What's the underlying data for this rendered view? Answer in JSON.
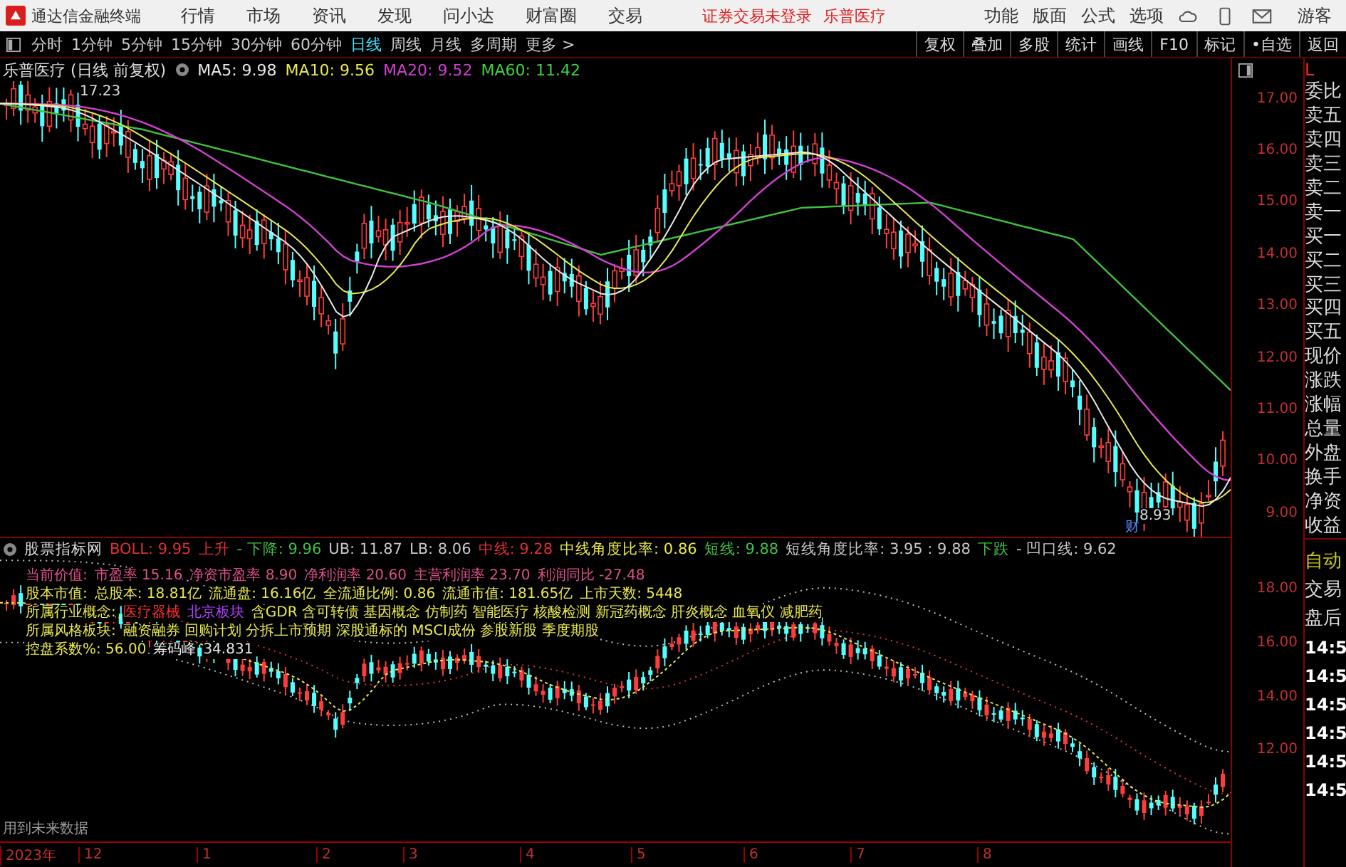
{
  "menu_bar": {
    "app_title": "通达信金融终端",
    "menus": [
      "行情",
      "市场",
      "资讯",
      "发现",
      "问小达",
      "财富圈",
      "交易"
    ],
    "login_status": "证券交易未登录",
    "stock_name": "乐普医疗",
    "right_menus": [
      "功能",
      "版面",
      "公式",
      "选项"
    ],
    "user": "游客"
  },
  "toolbar": {
    "periods": [
      {
        "label": "分时",
        "selected": false
      },
      {
        "label": "1分钟",
        "selected": false
      },
      {
        "label": "5分钟",
        "selected": false
      },
      {
        "label": "15分钟",
        "selected": false
      },
      {
        "label": "30分钟",
        "selected": false
      },
      {
        "label": "60分钟",
        "selected": false
      },
      {
        "label": "日线",
        "selected": true
      },
      {
        "label": "周线",
        "selected": false
      },
      {
        "label": "月线",
        "selected": false
      },
      {
        "label": "多周期",
        "selected": false
      }
    ],
    "more": "更多 >",
    "actions": [
      "复权",
      "叠加",
      "多股",
      "统计",
      "画线",
      "F10",
      "标记",
      "•自选",
      "返回"
    ]
  },
  "main_chart": {
    "title": "乐普医疗 (日线 前复权)",
    "indicators": [
      {
        "text": "MA5: 9.98",
        "color": "#e8e8e8"
      },
      {
        "text": "MA10: 9.56",
        "color": "#e8e850"
      },
      {
        "text": "MA20: 9.52",
        "color": "#d040d0"
      },
      {
        "text": "MA60: 11.42",
        "color": "#40d040"
      }
    ],
    "high_label": "17.23",
    "low_label": "8.93",
    "marker": "财",
    "y_ticks": [
      "17.00",
      "16.00",
      "15.00",
      "14.00",
      "13.00",
      "12.00",
      "11.00",
      "10.00",
      "9.00"
    ]
  },
  "indicator_panel": {
    "title": "股票指标网",
    "readouts": [
      {
        "text": "BOLL: 9.95",
        "color": "#e03030"
      },
      {
        "text": "上升",
        "color": "#e03030"
      },
      {
        "text": "- 下降: 9.96",
        "color": "#40c040"
      },
      {
        "text": "UB: 11.87",
        "color": "#c8c8c8"
      },
      {
        "text": "LB: 8.06",
        "color": "#c8c8c8"
      },
      {
        "text": "中线: 9.28",
        "color": "#e03030"
      },
      {
        "text": "中线角度比率: 0.86",
        "color": "#e8e850"
      },
      {
        "text": "短线: 9.88",
        "color": "#40c040"
      },
      {
        "text": "短线角度比率: 3.95 : 9.88",
        "color": "#c8c8c8"
      },
      {
        "text": "下跌",
        "color": "#40c040"
      },
      {
        "text": "- 凹口线: 9.62",
        "color": "#c8c8c8"
      }
    ],
    "info_rows": [
      [
        {
          "text": "当前价值:",
          "color": "#e0508a"
        },
        {
          "text": "市盈率 15.16",
          "color": "#e0508a"
        },
        {
          "text": "净资市盈率 8.90",
          "color": "#e0508a"
        },
        {
          "text": "净利润率 20.60",
          "color": "#e0508a"
        },
        {
          "text": "主营利润率 23.70",
          "color": "#e0508a"
        },
        {
          "text": "利润同比 -27.48",
          "color": "#e0508a"
        }
      ],
      [
        {
          "text": "股本市值:",
          "color": "#e8e850"
        },
        {
          "text": "总股本: 18.81亿",
          "color": "#e8e850"
        },
        {
          "text": "流通盘: 16.16亿",
          "color": "#e8e850"
        },
        {
          "text": "全流通比例: 0.86",
          "color": "#e8e850"
        },
        {
          "text": "流通市值: 181.65亿",
          "color": "#e8e850"
        },
        {
          "text": "上市天数: 5448",
          "color": "#e8e850"
        }
      ],
      [
        {
          "text": "所属行业概念:",
          "color": "#e8e850"
        },
        {
          "text": "医疗器械",
          "color": "#ff3030"
        },
        {
          "text": "北京板块",
          "color": "#b040ff"
        },
        {
          "text": "含GDR 含可转债 基因概念 仿制药 智能医疗 核酸检测 新冠药概念 肝炎概念 血氧仪 减肥药",
          "color": "#e8e850"
        }
      ],
      [
        {
          "text": "所属风格板块:",
          "color": "#e8e850"
        },
        {
          "text": "融资融券 回购计划 分拆上市预期 深股通标的 MSCI成份 参股新股 季度期股",
          "color": "#e8e850"
        }
      ],
      [
        {
          "text": "控盘系数%: 56.00",
          "color": "#e8e850"
        },
        {
          "text": "筹码峰",
          "color": "#e8e8e8"
        },
        {
          "text": "34.831",
          "color": "#e8e8e8"
        }
      ]
    ],
    "y_ticks": [
      "18.00",
      "16.00",
      "14.00",
      "12.00"
    ],
    "note": "用到未来数据"
  },
  "right_panel": {
    "corner": "L",
    "quote_labels": [
      "委比",
      "卖五",
      "卖四",
      "卖三",
      "卖二",
      "卖一",
      "买一",
      "买二",
      "买三",
      "买四",
      "买五",
      "现价",
      "涨跌",
      "涨幅",
      "总量",
      "外盘",
      "换手",
      "净资",
      "收益"
    ],
    "lower_labels": [
      {
        "text": "自动",
        "kind": "status"
      },
      {
        "text": "交易",
        "kind": "label"
      },
      {
        "text": "盘后",
        "kind": "label"
      },
      {
        "text": "14:5",
        "kind": "time"
      },
      {
        "text": "14:5",
        "kind": "time"
      },
      {
        "text": "14:5",
        "kind": "time"
      },
      {
        "text": "14:5",
        "kind": "time"
      },
      {
        "text": "14:5",
        "kind": "time"
      },
      {
        "text": "14:5",
        "kind": "time"
      }
    ]
  },
  "time_axis": [
    "2023年",
    "12",
    "1",
    "2",
    "3",
    "4",
    "5",
    "6",
    "7",
    "8"
  ]
}
